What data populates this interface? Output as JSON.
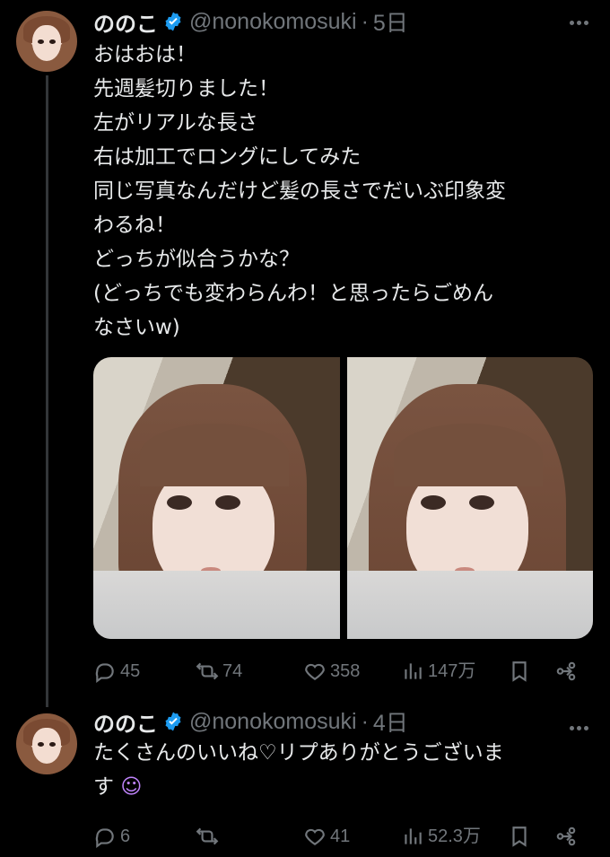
{
  "tweets": [
    {
      "user": {
        "name": "ののこ",
        "handle": "@nonokomosuki",
        "time": "5日"
      },
      "lines": [
        "おはおは！",
        "先週髪切りました！",
        "左がリアルな長さ",
        "右は加工でロングにしてみた",
        "同じ写真なんだけど髪の長さでだいぶ印象変",
        "わるね！",
        "どっちが似合うかな？",
        "(どっちでも変わらんわ！と思ったらごめん",
        "なさいw)"
      ],
      "metrics": {
        "replies": "45",
        "retweets": "74",
        "likes": "358",
        "views": "147万"
      }
    },
    {
      "user": {
        "name": "ののこ",
        "handle": "@nonokomosuki",
        "time": "4日"
      },
      "lines": [
        "たくさんのいいね♡リプありがとうございま",
        "す"
      ],
      "emoji": "☺",
      "metrics": {
        "replies": "6",
        "retweets": "",
        "likes": "41",
        "views": "52.3万"
      }
    }
  ],
  "icons": {
    "reply": "reply-icon",
    "retweet": "retweet-icon",
    "like": "heart-icon",
    "views": "views-icon",
    "bookmark": "bookmark-icon",
    "share": "share-icon",
    "verified": "verified-badge-icon",
    "more": "more-icon"
  },
  "colors": {
    "background": "#000000",
    "text": "#e7e9ea",
    "secondary": "#71767b",
    "verified": "#1d9bf0",
    "thread_line": "#333639",
    "emoji": "#c084fc"
  }
}
